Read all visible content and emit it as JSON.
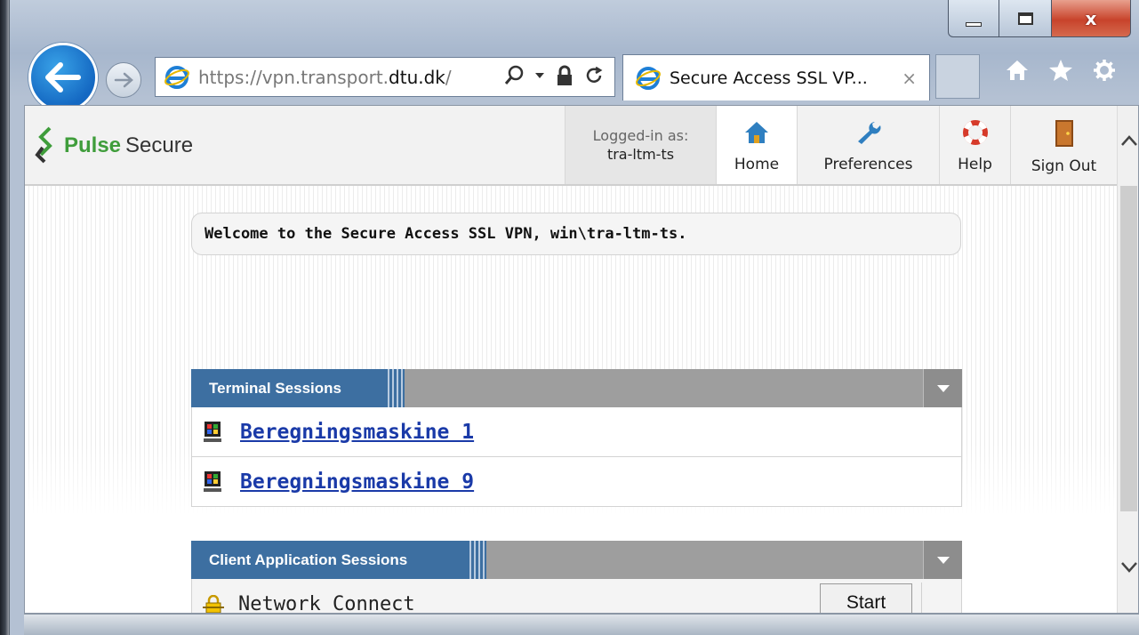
{
  "browser": {
    "address_prefix": "https://vpn.transport.",
    "address_domain": "dtu.dk",
    "address_suffix": "/",
    "tab_title": "Secure Access SSL VP...",
    "tab_close": "×"
  },
  "window_controls": {
    "close": "x"
  },
  "header": {
    "logo_part1": "Pulse",
    "logo_part2": "Secure",
    "logged_in_label": "Logged-in as:",
    "logged_in_user": "tra-ltm-ts",
    "nav": {
      "home": "Home",
      "preferences": "Preferences",
      "help": "Help",
      "sign_out": "Sign Out"
    }
  },
  "welcome": "Welcome to the Secure Access SSL VPN, win\\tra-ltm-ts.",
  "terminal_sessions": {
    "title": "Terminal Sessions",
    "items": [
      {
        "label": "Beregningsmaskine 1"
      },
      {
        "label": "Beregningsmaskine 9"
      }
    ]
  },
  "client_sessions": {
    "title": "Client Application Sessions",
    "items": [
      {
        "label": "Network Connect",
        "button": "Start"
      }
    ]
  },
  "colors": {
    "panel_header": "#3d6fa1",
    "link": "#1a3aa8",
    "logo_green": "#3f9d3b"
  }
}
